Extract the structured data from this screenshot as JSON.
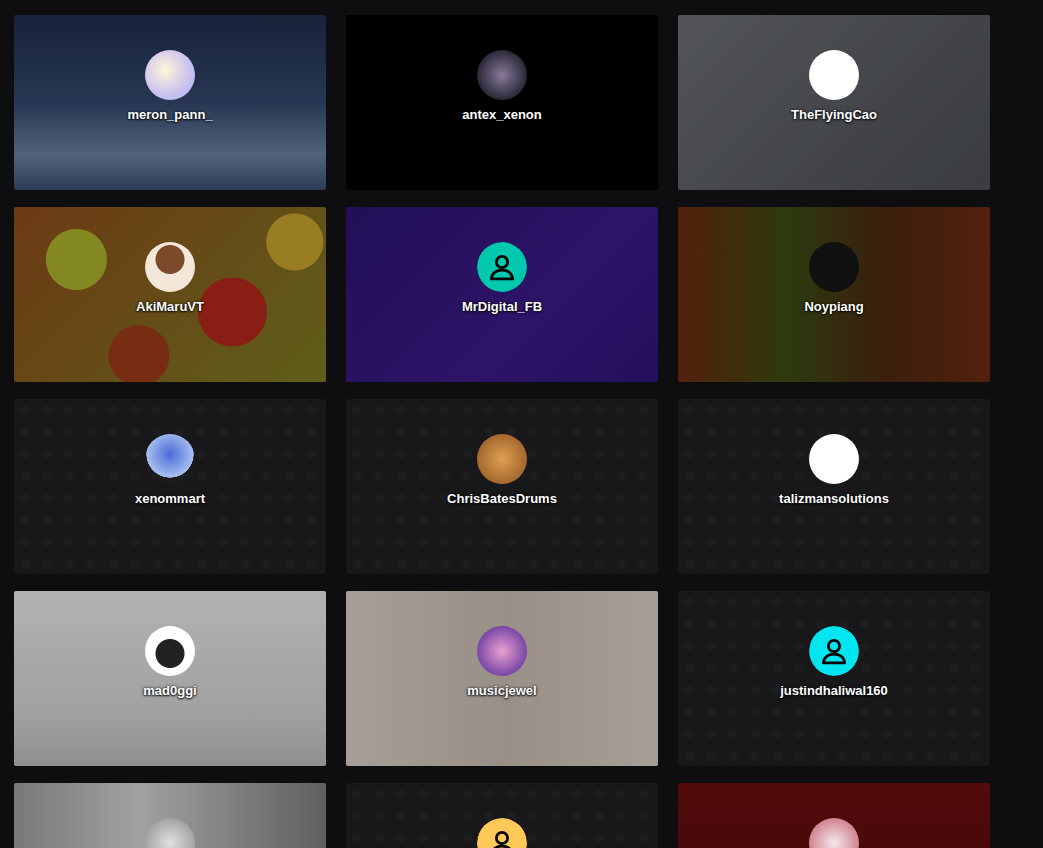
{
  "channels": [
    {
      "name": "meron_pann_",
      "banner": "image",
      "avatar": {
        "kind": "image"
      }
    },
    {
      "name": "antex_xenon",
      "banner": "image",
      "avatar": {
        "kind": "image"
      }
    },
    {
      "name": "TheFlyingCao",
      "banner": "image",
      "avatar": {
        "kind": "image"
      }
    },
    {
      "name": "AkiMaruVT",
      "banner": "image",
      "avatar": {
        "kind": "image"
      }
    },
    {
      "name": "MrDigital_FB",
      "banner": "image",
      "avatar": {
        "kind": "default",
        "color": "#00c8af"
      }
    },
    {
      "name": "Noypiang",
      "banner": "image",
      "avatar": {
        "kind": "image"
      }
    },
    {
      "name": "xenommart",
      "banner": "default",
      "avatar": {
        "kind": "image"
      }
    },
    {
      "name": "ChrisBatesDrums",
      "banner": "default",
      "avatar": {
        "kind": "image"
      }
    },
    {
      "name": "talizmansolutions",
      "banner": "default",
      "avatar": {
        "kind": "image"
      }
    },
    {
      "name": "mad0ggi",
      "banner": "image",
      "avatar": {
        "kind": "image"
      }
    },
    {
      "name": "musicjewel",
      "banner": "image",
      "avatar": {
        "kind": "image"
      }
    },
    {
      "name": "justindhaliwal160",
      "banner": "default",
      "avatar": {
        "kind": "default",
        "color": "#00e5f0"
      }
    },
    {
      "banner": "image",
      "avatar": {
        "kind": "image"
      }
    },
    {
      "banner": "default",
      "avatar": {
        "kind": "default",
        "color": "#ffc857"
      }
    },
    {
      "banner": "image",
      "avatar": {
        "kind": "image"
      }
    }
  ]
}
